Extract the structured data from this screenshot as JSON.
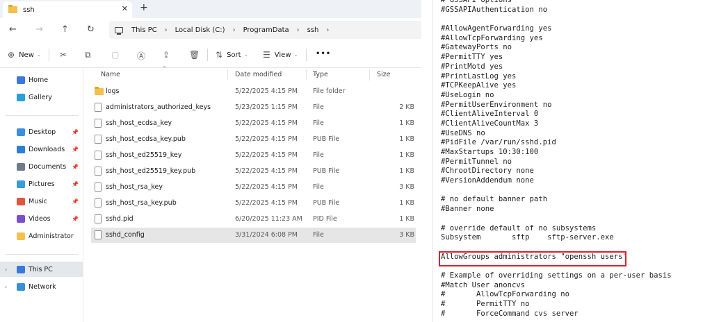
{
  "explorer": {
    "tab_title": "ssh",
    "breadcrumb": [
      "This PC",
      "Local Disk (C:)",
      "ProgramData",
      "ssh"
    ],
    "toolbar": {
      "new_label": "New",
      "sort_label": "Sort",
      "view_label": "View",
      "more_label": "•••"
    },
    "nav": {
      "quick": [
        {
          "label": "Home",
          "color": "#3b78d8"
        },
        {
          "label": "Gallery",
          "color": "#2a9fd6"
        }
      ],
      "pinned": [
        {
          "label": "Desktop",
          "color": "#3b8ee0"
        },
        {
          "label": "Downloads",
          "color": "#2d7fd0"
        },
        {
          "label": "Documents",
          "color": "#6f7b8a"
        },
        {
          "label": "Pictures",
          "color": "#3a9bd5"
        },
        {
          "label": "Music",
          "color": "#e0553f"
        },
        {
          "label": "Videos",
          "color": "#7b4fd0"
        },
        {
          "label": "Administrator",
          "color": "#f2c14e"
        }
      ],
      "tree": [
        {
          "label": "This PC",
          "color": "#3b78d8"
        },
        {
          "label": "Network",
          "color": "#3a8fd0"
        }
      ]
    },
    "columns": [
      "Name",
      "Date modified",
      "Type",
      "Size"
    ],
    "files": [
      {
        "name": "logs",
        "date": "5/22/2025 4:15 PM",
        "type": "File folder",
        "size": "",
        "folder": true
      },
      {
        "name": "administrators_authorized_keys",
        "date": "5/23/2025 1:15 PM",
        "type": "File",
        "size": "2 KB"
      },
      {
        "name": "ssh_host_ecdsa_key",
        "date": "5/22/2025 4:15 PM",
        "type": "File",
        "size": "1 KB"
      },
      {
        "name": "ssh_host_ecdsa_key.pub",
        "date": "5/22/2025 4:15 PM",
        "type": "PUB File",
        "size": "1 KB"
      },
      {
        "name": "ssh_host_ed25519_key",
        "date": "5/22/2025 4:15 PM",
        "type": "File",
        "size": "1 KB"
      },
      {
        "name": "ssh_host_ed25519_key.pub",
        "date": "5/22/2025 4:15 PM",
        "type": "PUB File",
        "size": "1 KB"
      },
      {
        "name": "ssh_host_rsa_key",
        "date": "5/22/2025 4:15 PM",
        "type": "File",
        "size": "3 KB"
      },
      {
        "name": "ssh_host_rsa_key.pub",
        "date": "5/22/2025 4:15 PM",
        "type": "PUB File",
        "size": "1 KB"
      },
      {
        "name": "sshd.pid",
        "date": "6/20/2025 11:23 AM",
        "type": "PID File",
        "size": "1 KB"
      },
      {
        "name": "sshd_config",
        "date": "3/31/2024 6:08 PM",
        "type": "File",
        "size": "3 KB",
        "selected": true
      }
    ]
  },
  "editor": {
    "lines": [
      "# GSSAPI options",
      "#GSSAPIAuthentication no",
      "",
      "#AllowAgentForwarding yes",
      "#AllowTcpForwarding yes",
      "#GatewayPorts no",
      "#PermitTTY yes",
      "#PrintMotd yes",
      "#PrintLastLog yes",
      "#TCPKeepAlive yes",
      "#UseLogin no",
      "#PermitUserEnvironment no",
      "#ClientAliveInterval 0",
      "#ClientAliveCountMax 3",
      "#UseDNS no",
      "#PidFile /var/run/sshd.pid",
      "#MaxStartups 10:30:100",
      "#PermitTunnel no",
      "#ChrootDirectory none",
      "#VersionAddendum none",
      "",
      "# no default banner path",
      "#Banner none",
      "",
      "# override default of no subsystems",
      "Subsystem       sftp    sftp-server.exe",
      "",
      "AllowGroups administrators \"openssh users\"",
      "",
      "# Example of overriding settings on a per-user basis",
      "#Match User anoncvs",
      "#       AllowTcpForwarding no",
      "#       PermitTTY no",
      "#       ForceCommand cvs server"
    ],
    "highlight_color": "#d8202a"
  }
}
